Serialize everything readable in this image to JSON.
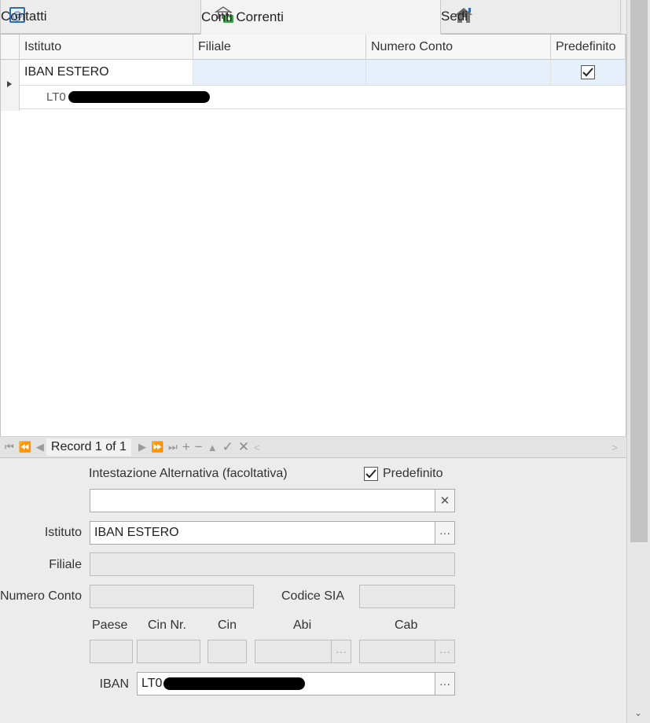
{
  "tabs": [
    {
      "label": "Contatti",
      "icon": "at-sign-icon"
    },
    {
      "label": "Conti Correnti",
      "icon": "bank-money-icon"
    },
    {
      "label": "Sedi",
      "icon": "house-icon"
    }
  ],
  "grid": {
    "columns": [
      "Istituto",
      "Filiale",
      "Numero Conto",
      "Predefinito"
    ],
    "rows": [
      {
        "istituto": "IBAN ESTERO",
        "filiale": "",
        "numero_conto": "",
        "predefinito": true,
        "detail_prefix": "LT0"
      }
    ]
  },
  "navigator": {
    "record_text": "Record 1 of 1"
  },
  "form": {
    "intestazione_label": "Intestazione Alternativa (facoltativa)",
    "intestazione_value": "",
    "predefinito_label": "Predefinito",
    "predefinito_checked": true,
    "istituto_label": "Istituto",
    "istituto_value": "IBAN ESTERO",
    "filiale_label": "Filiale",
    "filiale_value": "",
    "numero_conto_label": "Numero Conto",
    "numero_conto_value": "",
    "codice_sia_label": "Codice SIA",
    "codice_sia_value": "",
    "paese_label": "Paese",
    "cin_nr_label": "Cin Nr.",
    "cin_label": "Cin",
    "abi_label": "Abi",
    "cab_label": "Cab",
    "iban_label": "IBAN",
    "iban_prefix": "LT0",
    "ellipsis": "···",
    "clear_symbol": "✕"
  }
}
